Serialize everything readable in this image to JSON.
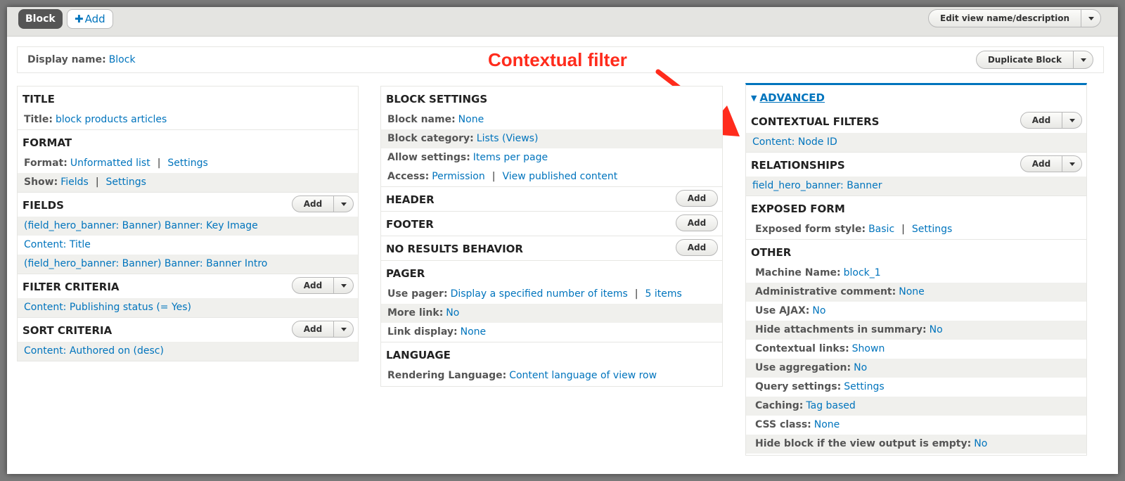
{
  "topbar": {
    "display_tab": "Block",
    "add_tab": "Add",
    "edit_view_btn": "Edit view name/description"
  },
  "display_bar": {
    "label": "Display name:",
    "value": "Block",
    "duplicate_btn": "Duplicate Block"
  },
  "annotation": "Contextual filter",
  "buttons": {
    "add": "Add"
  },
  "left": {
    "title": {
      "heading": "TITLE",
      "label": "Title:",
      "value": "block products articles"
    },
    "format": {
      "heading": "FORMAT",
      "format_label": "Format:",
      "format_value": "Unformatted list",
      "format_settings": "Settings",
      "show_label": "Show:",
      "show_value": "Fields",
      "show_settings": "Settings"
    },
    "fields": {
      "heading": "FIELDS",
      "items": [
        "(field_hero_banner: Banner) Banner: Key Image",
        "Content: Title",
        "(field_hero_banner: Banner) Banner: Banner Intro"
      ]
    },
    "filter": {
      "heading": "FILTER CRITERIA",
      "item": "Content: Publishing status (= Yes)"
    },
    "sort": {
      "heading": "SORT CRITERIA",
      "item": "Content: Authored on (desc)"
    }
  },
  "middle": {
    "block_settings": {
      "heading": "BLOCK SETTINGS",
      "name_label": "Block name:",
      "name_value": "None",
      "category_label": "Block category:",
      "category_value": "Lists (Views)",
      "allow_label": "Allow settings:",
      "allow_value": "Items per page",
      "access_label": "Access:",
      "access_value": "Permission",
      "access_value2": "View published content"
    },
    "header": "HEADER",
    "footer": "FOOTER",
    "no_results": "NO RESULTS BEHAVIOR",
    "pager": {
      "heading": "PAGER",
      "use_label": "Use pager:",
      "use_value": "Display a specified number of items",
      "use_value2": "5 items",
      "more_label": "More link:",
      "more_value": "No",
      "link_label": "Link display:",
      "link_value": "None"
    },
    "language": {
      "heading": "LANGUAGE",
      "label": "Rendering Language:",
      "value": "Content language of view row"
    }
  },
  "right": {
    "advanced": "ADVANCED",
    "contextual": {
      "heading": "CONTEXTUAL FILTERS",
      "item": "Content: Node ID"
    },
    "relationships": {
      "heading": "RELATIONSHIPS",
      "item": "field_hero_banner: Banner"
    },
    "exposed": {
      "heading": "EXPOSED FORM",
      "label": "Exposed form style:",
      "value": "Basic",
      "settings": "Settings"
    },
    "other": {
      "heading": "OTHER",
      "rows": [
        {
          "label": "Machine Name:",
          "value": "block_1"
        },
        {
          "label": "Administrative comment:",
          "value": "None"
        },
        {
          "label": "Use AJAX:",
          "value": "No"
        },
        {
          "label": "Hide attachments in summary:",
          "value": "No"
        },
        {
          "label": "Contextual links:",
          "value": "Shown"
        },
        {
          "label": "Use aggregation:",
          "value": "No"
        },
        {
          "label": "Query settings:",
          "value": "Settings"
        },
        {
          "label": "Caching:",
          "value": "Tag based"
        },
        {
          "label": "CSS class:",
          "value": "None"
        },
        {
          "label": "Hide block if the view output is empty:",
          "value": "No"
        }
      ]
    }
  }
}
